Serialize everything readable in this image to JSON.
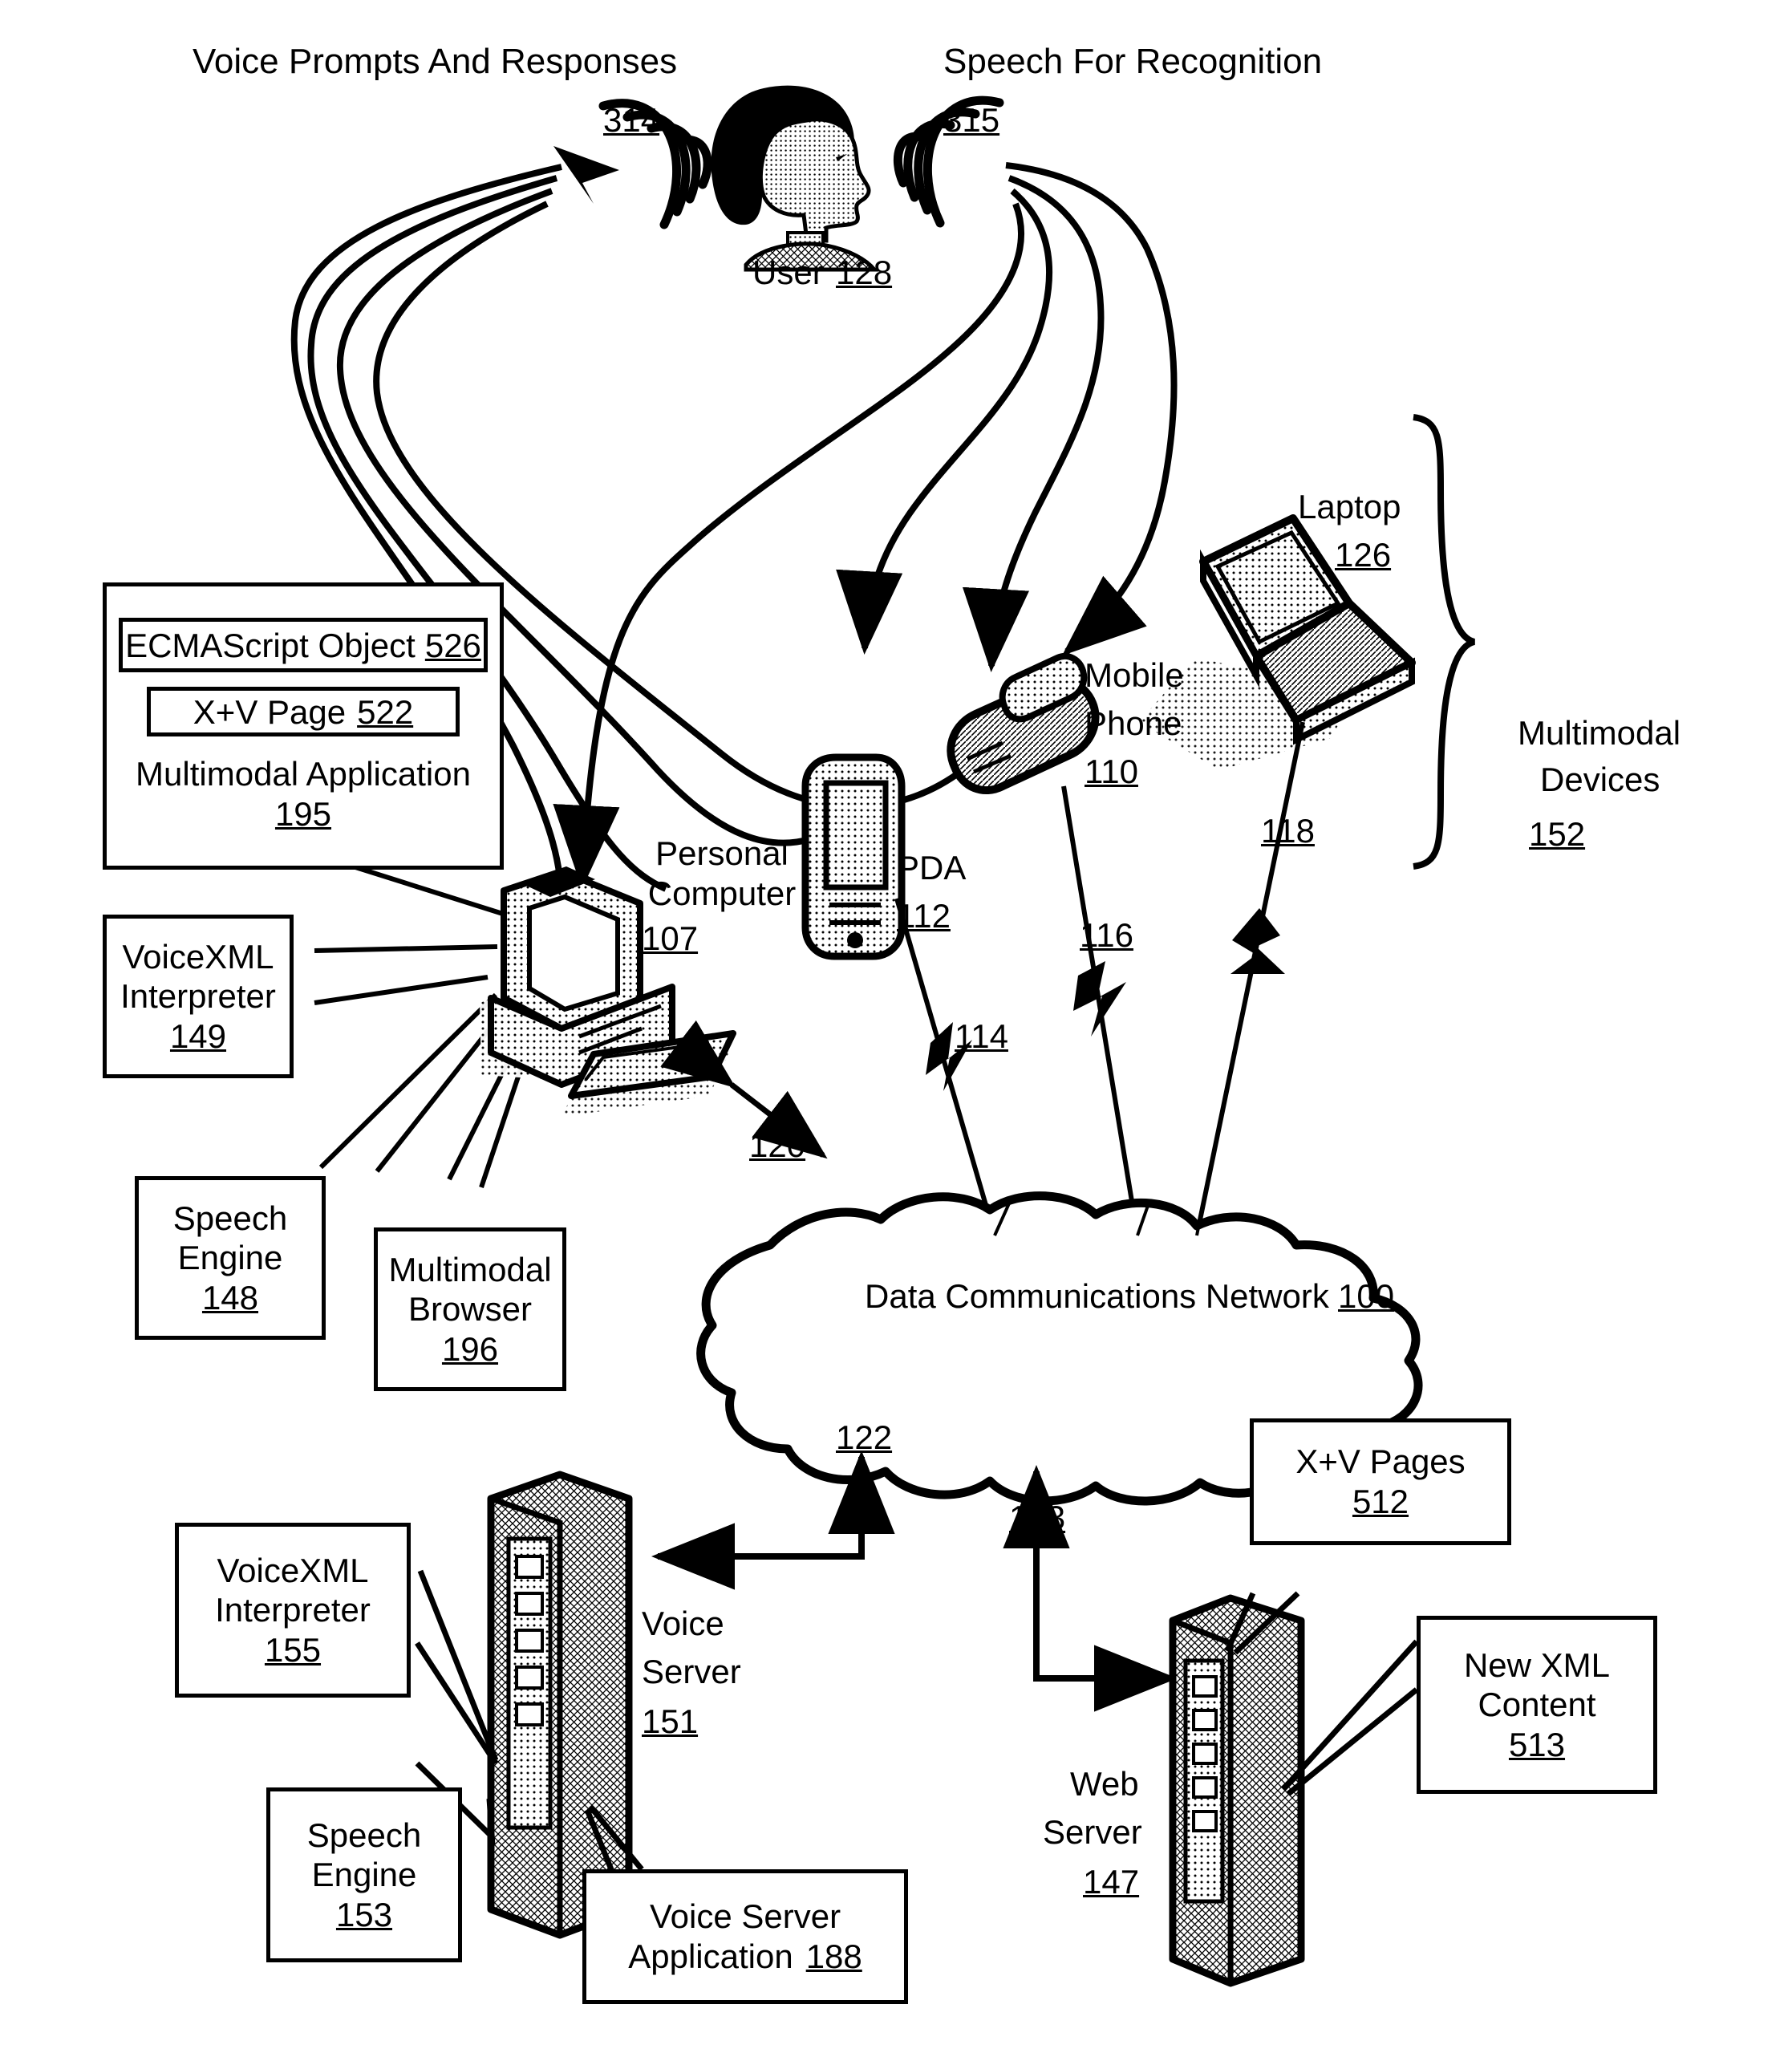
{
  "figure": {
    "headers": {
      "left": "Voice Prompts And Responses",
      "left_ref": "314",
      "right": "Speech For Recognition",
      "right_ref": "315"
    },
    "user": {
      "label": "User",
      "ref": "128"
    },
    "devices": [
      {
        "name": "Personal\nComputer",
        "label_line1": "Personal",
        "label_line2": "Computer",
        "ref": "107"
      },
      {
        "name": "PDA",
        "label_line1": "PDA",
        "label_line2": "",
        "ref": "112"
      },
      {
        "name": "Mobile Phone",
        "label_line1": "Mobile",
        "label_line2": "Phone",
        "ref": "110"
      },
      {
        "name": "Laptop",
        "label_line1": "Laptop",
        "label_line2": "",
        "ref": "126"
      }
    ],
    "brace_label": {
      "line1": "Multimodal",
      "line2": "Devices",
      "ref": "152"
    },
    "connections": [
      {
        "ref": "120",
        "kind": "wired-bidirectional"
      },
      {
        "ref": "114",
        "kind": "wireless"
      },
      {
        "ref": "116",
        "kind": "wireless"
      },
      {
        "ref": "118",
        "kind": "wireless"
      },
      {
        "ref": "122",
        "kind": "wired"
      },
      {
        "ref": "123",
        "kind": "wired"
      }
    ],
    "network_cloud": {
      "label": "Data Communications Network",
      "ref": "100"
    },
    "callouts": {
      "multimodal_application": {
        "title": "Multimodal Application",
        "ref": "195",
        "children": [
          {
            "title": "ECMAScript Object",
            "ref": "526"
          },
          {
            "title": "X+V Page",
            "ref": "522"
          }
        ]
      },
      "voicexml_interpreter_client": {
        "line1": "VoiceXML",
        "line2": "Interpreter",
        "ref": "149"
      },
      "speech_engine_client": {
        "line1": "Speech",
        "line2": "Engine",
        "ref": "148"
      },
      "multimodal_browser": {
        "line1": "Multimodal",
        "line2": "Browser",
        "ref": "196"
      },
      "voicexml_interpreter_server": {
        "line1": "VoiceXML",
        "line2": "Interpreter",
        "ref": "155"
      },
      "speech_engine_server": {
        "line1": "Speech",
        "line2": "Engine",
        "ref": "153"
      },
      "voice_server_application": {
        "line1": "Voice Server",
        "line2": "Application",
        "ref": "188"
      },
      "xv_pages": {
        "line1": "X+V Pages",
        "ref": "512"
      },
      "new_xml_content": {
        "line1": "New XML",
        "line2": "Content",
        "ref": "513"
      }
    },
    "servers": {
      "voice_server": {
        "line1": "Voice",
        "line2": "Server",
        "ref": "151"
      },
      "web_server": {
        "line1": "Web",
        "line2": "Server",
        "ref": "147"
      }
    }
  }
}
